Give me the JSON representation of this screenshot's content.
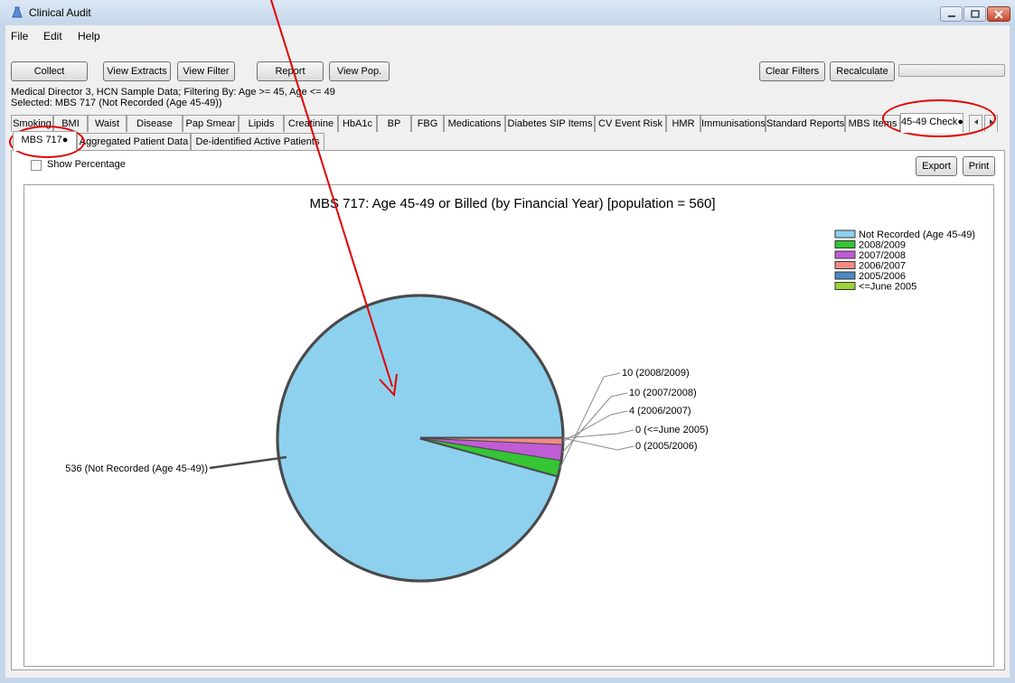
{
  "window": {
    "title": "Clinical Audit"
  },
  "menu": [
    "File",
    "Edit",
    "Help"
  ],
  "toolbar": {
    "collect": "Collect",
    "view_extracts": "View Extracts",
    "view_filter": "View Filter",
    "report": "Report",
    "view_pop": "View Pop.",
    "clear_filters": "Clear Filters",
    "recalculate": "Recalculate"
  },
  "info": {
    "line1": "Medical Director 3, HCN Sample Data; Filtering By: Age >= 45, Age <= 49",
    "line2": "Selected: MBS 717 (Not Recorded (Age 45-49))"
  },
  "main_tabs": [
    "Smoking",
    "BMI",
    "Waist",
    "Disease",
    "Pap Smear",
    "Lipids",
    "Creatinine",
    "HbA1c",
    "BP",
    "FBG",
    "Medications",
    "Diabetes SIP Items",
    "CV Event Risk",
    "HMR",
    "Immunisations",
    "Standard Reports",
    "MBS Items",
    "45-49 Check●"
  ],
  "sub_tabs": [
    "MBS 717●",
    "Aggregated Patient Data",
    "De-identified Active Patients"
  ],
  "options": {
    "show_percentage": "Show Percentage",
    "export": "Export",
    "print": "Print"
  },
  "colors": {
    "accent_annotation": "#e10000"
  },
  "chart_data": {
    "type": "pie",
    "title": "MBS 717: Age 45-49 or Billed (by Financial Year) [population = 560]",
    "slices": [
      {
        "name": "Not Recorded (Age 45-49)",
        "value": 536,
        "color": "#8ed1ee",
        "label": "536 (Not Recorded (Age 45-49))"
      },
      {
        "name": "2008/2009",
        "value": 10,
        "color": "#35c535",
        "label": "10 (2008/2009)"
      },
      {
        "name": "2007/2008",
        "value": 10,
        "color": "#bf5cd6",
        "label": "10 (2007/2008)"
      },
      {
        "name": "2006/2007",
        "value": 4,
        "color": "#f08a84",
        "label": "4 (2006/2007)"
      },
      {
        "name": "2005/2006",
        "value": 0,
        "color": "#4b89be",
        "label": "0 (2005/2006)"
      },
      {
        "name": "<=June 2005",
        "value": 0,
        "color": "#9bd33a",
        "label": "0 (<=June 2005)"
      }
    ],
    "legend": [
      "Not Recorded (Age 45-49)",
      "2008/2009",
      "2007/2008",
      "2006/2007",
      "2005/2006",
      "<=June 2005"
    ],
    "legend_position": "top-right"
  }
}
